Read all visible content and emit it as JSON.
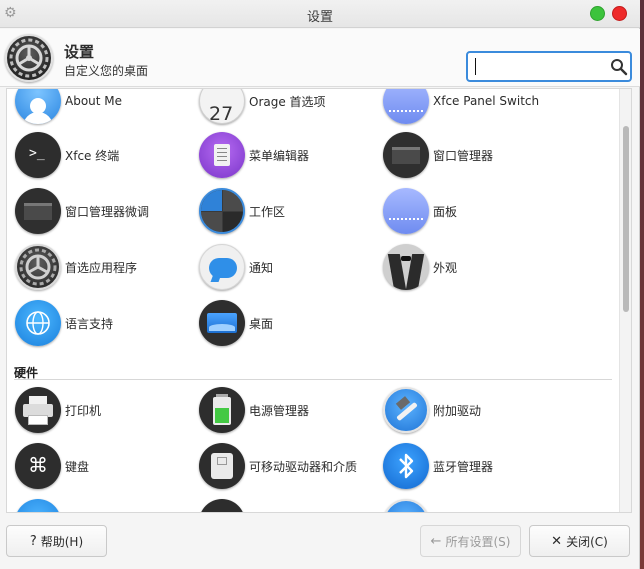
{
  "window": {
    "title": "设置",
    "accent": "#3b8bdc",
    "max_color": "#3cc33c",
    "close_color": "#ee2a2a"
  },
  "header": {
    "title": "设置",
    "subtitle": "自定义您的桌面",
    "icon": "settings-gear-icon"
  },
  "search": {
    "value": "",
    "placeholder": ""
  },
  "personal": [
    {
      "label": "About Me",
      "icon": "about-me-icon"
    },
    {
      "label": "Orage 首选项",
      "icon": "orage-calendar-icon"
    },
    {
      "label": "Xfce Panel Switch",
      "icon": "panel-switch-icon"
    },
    {
      "label": "Xfce 终端",
      "icon": "terminal-icon"
    },
    {
      "label": "菜单编辑器",
      "icon": "menu-editor-icon"
    },
    {
      "label": "窗口管理器",
      "icon": "window-manager-icon"
    },
    {
      "label": "窗口管理器微调",
      "icon": "window-manager-tweaks-icon"
    },
    {
      "label": "工作区",
      "icon": "workspaces-icon"
    },
    {
      "label": "面板",
      "icon": "panel-icon"
    },
    {
      "label": "首选应用程序",
      "icon": "preferred-apps-icon"
    },
    {
      "label": "通知",
      "icon": "notifications-icon"
    },
    {
      "label": "外观",
      "icon": "appearance-icon"
    },
    {
      "label": "语言支持",
      "icon": "language-support-icon"
    },
    {
      "label": "桌面",
      "icon": "desktop-icon"
    }
  ],
  "hardware": {
    "title": "硬件",
    "items": [
      {
        "label": "打印机",
        "icon": "printer-icon"
      },
      {
        "label": "电源管理器",
        "icon": "power-manager-icon"
      },
      {
        "label": "附加驱动",
        "icon": "additional-drivers-icon"
      },
      {
        "label": "键盘",
        "icon": "keyboard-icon"
      },
      {
        "label": "可移动驱动器和介质",
        "icon": "removable-drives-icon"
      },
      {
        "label": "蓝牙管理器",
        "icon": "bluetooth-icon"
      }
    ]
  },
  "footer": {
    "help_label": "帮助(H)",
    "all_settings_label": "所有设置(S)",
    "close_label": "关闭(C)"
  }
}
